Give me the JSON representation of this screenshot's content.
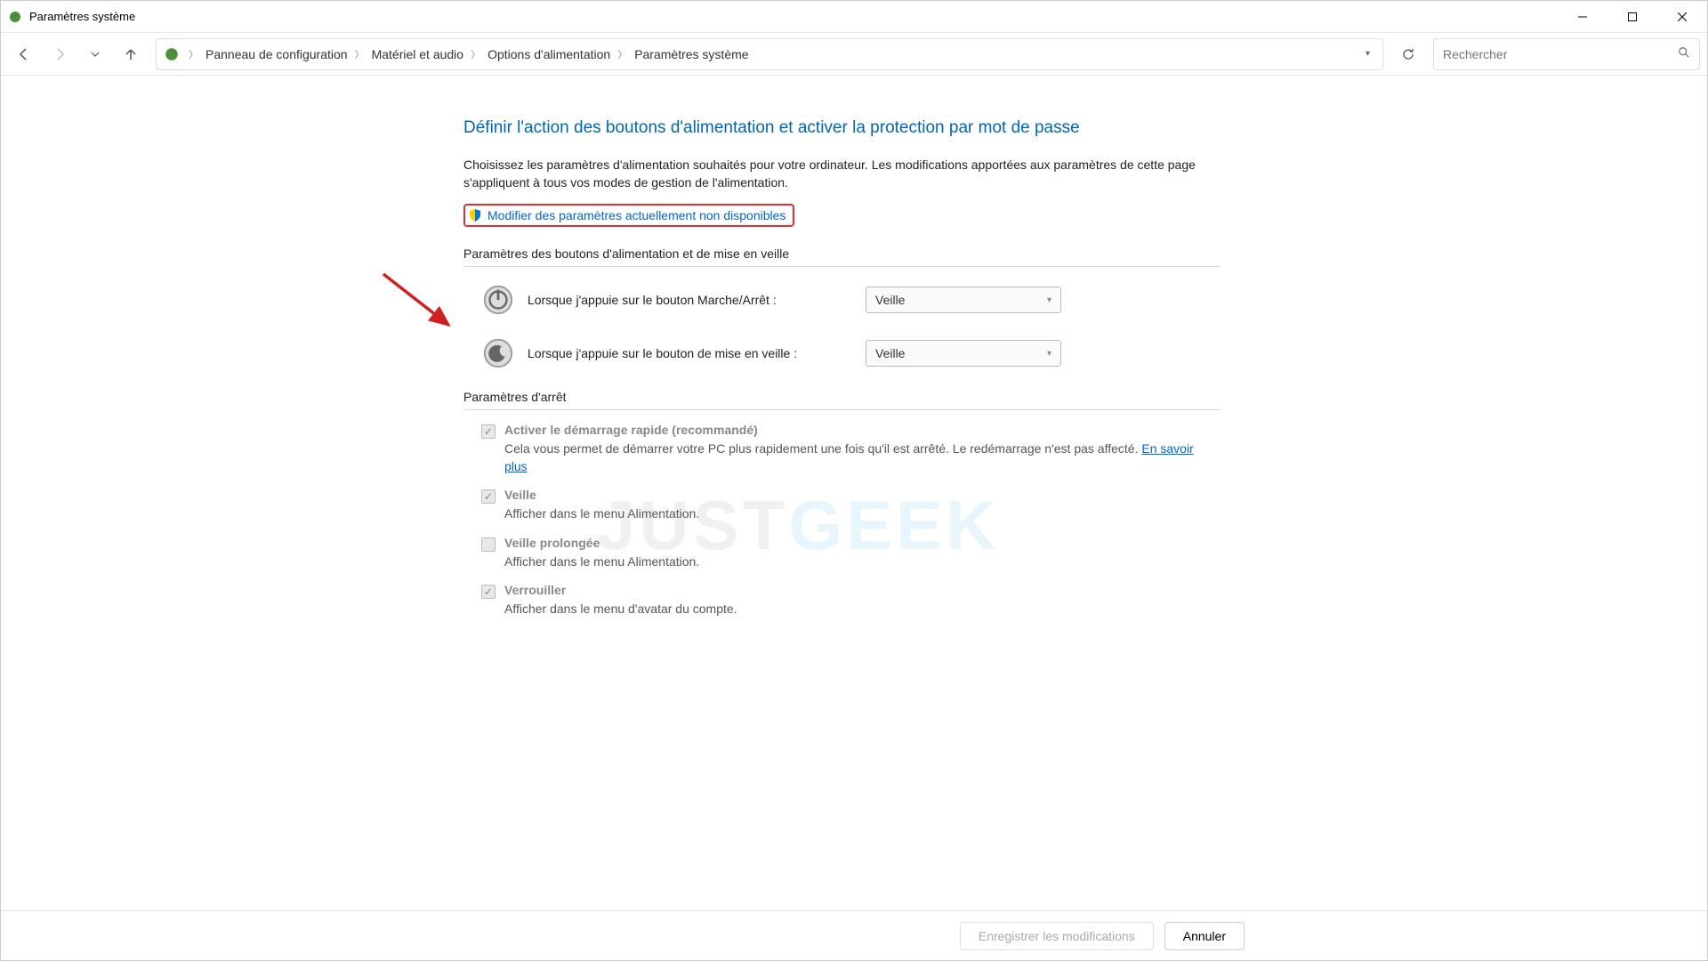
{
  "window": {
    "title": "Paramètres système"
  },
  "breadcrumb": {
    "seg1": "Panneau de configuration",
    "seg2": "Matériel et audio",
    "seg3": "Options d'alimentation",
    "seg4": "Paramètres système"
  },
  "search": {
    "placeholder": "Rechercher"
  },
  "page": {
    "title": "Définir l'action des boutons d'alimentation et activer la protection par mot de passe",
    "desc": "Choisissez les paramètres d'alimentation souhaités pour votre ordinateur. Les modifications apportées aux paramètres de cette page s'appliquent à tous vos modes de gestion de l'alimentation.",
    "uac_link": "Modifier des paramètres actuellement non disponibles"
  },
  "sections": {
    "buttons_header": "Paramètres des boutons d'alimentation et de mise en veille",
    "shutdown_header": "Paramètres d'arrêt"
  },
  "settings": {
    "power_label": "Lorsque j'appuie sur le bouton Marche/Arrêt :",
    "power_value": "Veille",
    "sleep_label": "Lorsque j'appuie sur le bouton de mise en veille :",
    "sleep_value": "Veille"
  },
  "checks": {
    "fastboot_label": "Activer le démarrage rapide (recommandé)",
    "fastboot_desc_a": "Cela vous permet de démarrer votre PC plus rapidement une fois qu'il est arrêté. Le redémarrage n'est pas affecté. ",
    "fastboot_link": "En savoir plus",
    "sleep_label": "Veille",
    "sleep_desc": "Afficher dans le menu Alimentation.",
    "hibernate_label": "Veille prolongée",
    "hibernate_desc": "Afficher dans le menu Alimentation.",
    "lock_label": "Verrouiller",
    "lock_desc": "Afficher dans le menu d'avatar du compte."
  },
  "footer": {
    "save": "Enregistrer les modifications",
    "cancel": "Annuler"
  },
  "watermark": {
    "a": "JUST",
    "b": "GEEK"
  }
}
